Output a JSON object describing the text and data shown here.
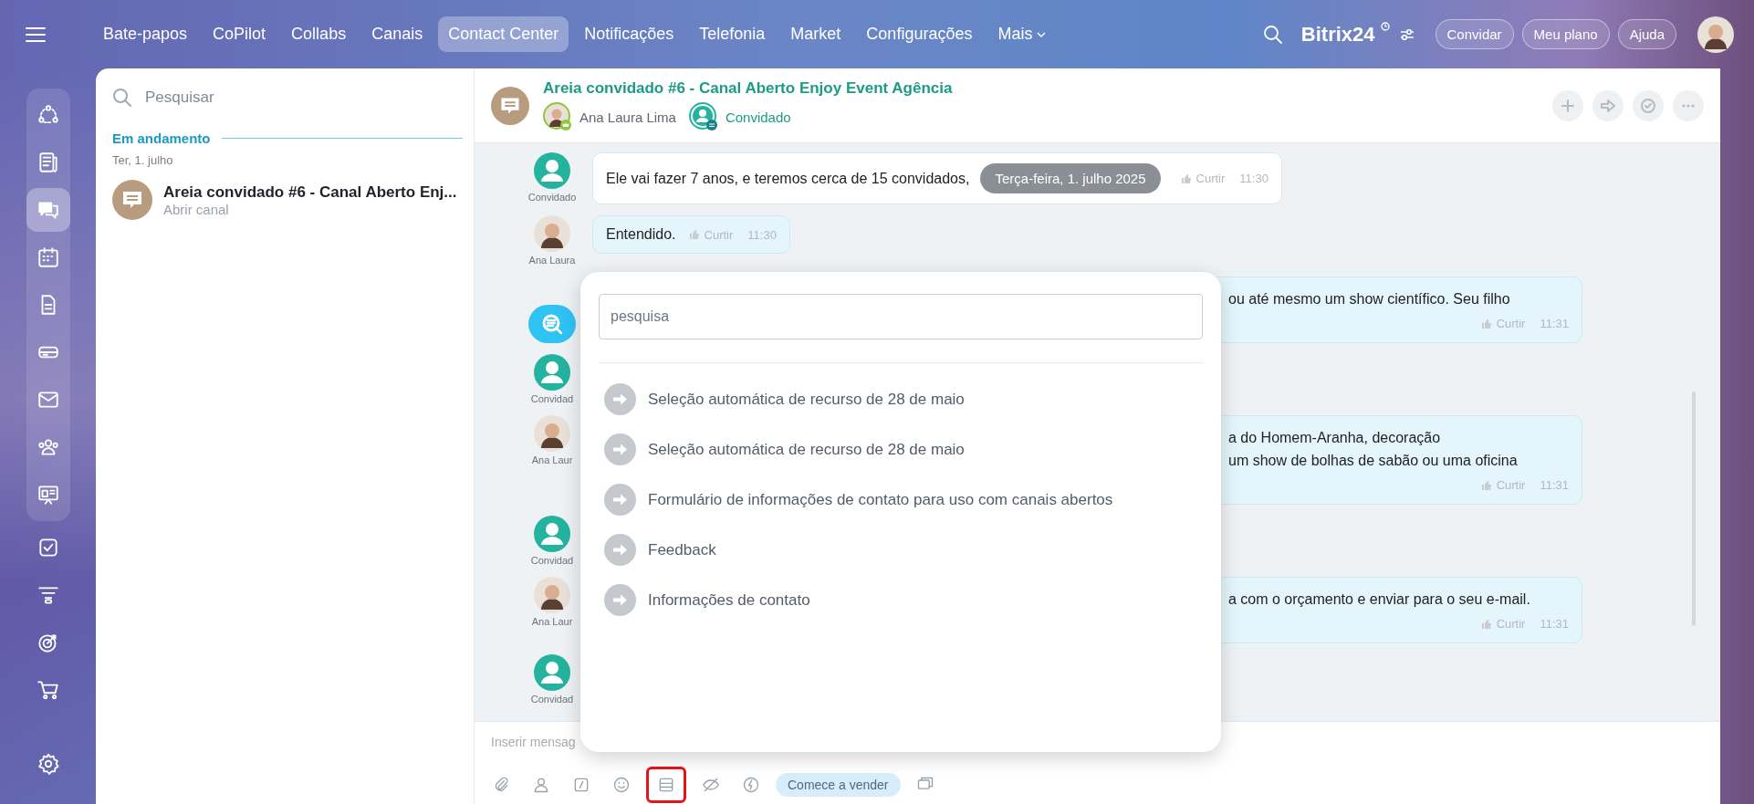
{
  "top_nav": {
    "items": [
      {
        "label": "Bate-papos",
        "selected": false
      },
      {
        "label": "CoPilot",
        "selected": false
      },
      {
        "label": "Collabs",
        "selected": false
      },
      {
        "label": "Canais",
        "selected": false
      },
      {
        "label": "Contact Center",
        "selected": true
      },
      {
        "label": "Notificações",
        "selected": false
      },
      {
        "label": "Telefonia",
        "selected": false
      },
      {
        "label": "Market",
        "selected": false
      },
      {
        "label": "Configurações",
        "selected": false
      }
    ],
    "more_menu": {
      "label": "Mais"
    },
    "logo": "Bitrix24",
    "buttons": [
      "Convidar",
      "Meu plano",
      "Ajuda"
    ]
  },
  "rail": {
    "items": [
      {
        "kind": "flow",
        "selected": false
      },
      {
        "kind": "feed",
        "selected": false
      },
      {
        "kind": "chat",
        "selected": true
      },
      {
        "kind": "calendar",
        "selected": false
      },
      {
        "kind": "document",
        "selected": false
      },
      {
        "kind": "drive",
        "selected": false
      },
      {
        "kind": "mail",
        "selected": false
      },
      {
        "kind": "people",
        "selected": false
      },
      {
        "kind": "board",
        "selected": false
      },
      {
        "kind": "tasks",
        "selected": false
      },
      {
        "kind": "funnel",
        "selected": false
      },
      {
        "kind": "target",
        "selected": false
      },
      {
        "kind": "cart",
        "selected": false
      }
    ]
  },
  "chat_list": {
    "search": {
      "placeholder": "Pesquisar"
    },
    "section": "Em andamento",
    "date": "Ter, 1. julho",
    "items": [
      {
        "title": "Areia convidado #6 - Canal Aberto Enj...",
        "subtitle": "Abrir canal",
        "selected": false
      }
    ]
  },
  "chat": {
    "title": "Areia convidado #6 - Canal Aberto Enjoy Event Agência",
    "members": [
      {
        "kind": "agent",
        "name": "Ana Laura Lima"
      },
      {
        "kind": "guest",
        "name": "Convidado"
      }
    ],
    "messages": [
      {
        "kind": "guest",
        "author": "Convidado",
        "lines": [
          "Ele vai fazer 7 anos, e teremos cerca de 15 convidados,"
        ],
        "date_divider": "Terça-feira, 1. julho 2025",
        "like": "Curtir",
        "time": "11:30",
        "partial": false
      },
      {
        "kind": "agent",
        "author": "Ana Laura",
        "lines": [
          "Entendido."
        ],
        "like": "Curtir",
        "time": "11:30",
        "partial": false
      },
      {
        "kind": "bot",
        "lines": [
          "ou até mesmo um show científico. Seu filho"
        ],
        "like": "Curtir",
        "time": "11:31",
        "partial": true
      },
      {
        "kind": "guest",
        "author": "Convidad"
      },
      {
        "kind": "agent",
        "author": "Ana Laur",
        "lines": [
          "a do Homem-Aranha, decoração",
          "um show de bolhas de sabão ou uma oficina"
        ],
        "like": "Curtir",
        "time": "11:31",
        "partial": true
      },
      {
        "kind": "guest",
        "author": "Convidad"
      },
      {
        "kind": "agent",
        "author": "Ana Laur",
        "lines": [
          "a com o orçamento e enviar para o seu e-mail."
        ],
        "like": "Curtir",
        "time": "11:31",
        "partial": true
      },
      {
        "kind": "guest",
        "author": "Convidad"
      }
    ],
    "input": {
      "placeholder": "Inserir mensag"
    },
    "tools": [
      {
        "kind": "attach",
        "highlighted": false
      },
      {
        "kind": "contact",
        "highlighted": false
      },
      {
        "kind": "command",
        "highlighted": false
      },
      {
        "kind": "emoji",
        "highlighted": false
      },
      {
        "kind": "form",
        "highlighted": true
      },
      {
        "kind": "hidden",
        "highlighted": false
      },
      {
        "kind": "lightning",
        "highlighted": false
      },
      {
        "kind": "sell",
        "label": "Comece a vender",
        "highlighted": false
      },
      {
        "kind": "windows",
        "highlighted": false
      }
    ]
  },
  "template_picker": {
    "search": {
      "placeholder": "pesquisa"
    },
    "items": [
      {
        "label": "Seleção automática de recurso de 28 de maio"
      },
      {
        "label": "Seleção automática de recurso de 28 de maio"
      },
      {
        "label": "Formulário de informações de contato para uso com canais abertos"
      },
      {
        "label": "Feedback"
      },
      {
        "label": "Informações de contato"
      }
    ]
  }
}
